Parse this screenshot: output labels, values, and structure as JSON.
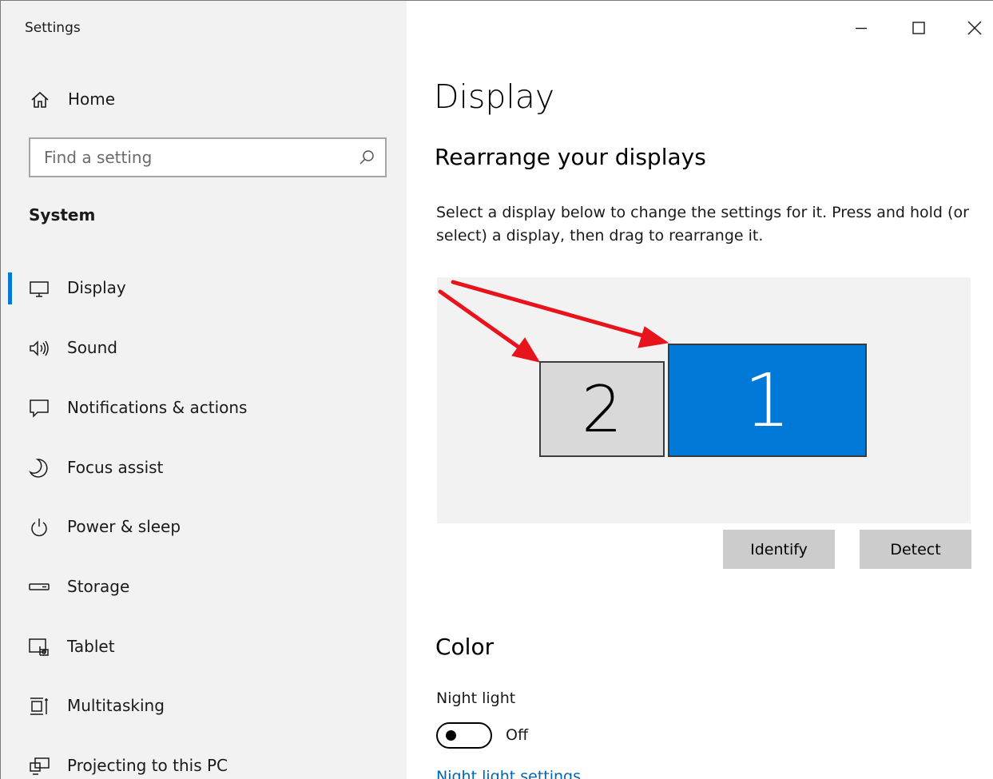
{
  "app": {
    "title": "Settings"
  },
  "window_controls": {
    "minimize": "minimize-icon",
    "maximize": "maximize-icon",
    "close": "close-icon"
  },
  "sidebar": {
    "home": {
      "label": "Home",
      "icon": "home-icon"
    },
    "search": {
      "placeholder": "Find a setting",
      "icon": "search-icon"
    },
    "section": "System",
    "items": [
      {
        "label": "Display",
        "icon": "monitor-icon",
        "active": true
      },
      {
        "label": "Sound",
        "icon": "speaker-icon"
      },
      {
        "label": "Notifications & actions",
        "icon": "notification-icon"
      },
      {
        "label": "Focus assist",
        "icon": "moon-icon"
      },
      {
        "label": "Power & sleep",
        "icon": "power-icon"
      },
      {
        "label": "Storage",
        "icon": "storage-icon"
      },
      {
        "label": "Tablet",
        "icon": "tablet-icon"
      },
      {
        "label": "Multitasking",
        "icon": "multitasking-icon"
      },
      {
        "label": "Projecting to this PC",
        "icon": "projecting-icon"
      }
    ]
  },
  "main": {
    "title": "Display",
    "rearrange": {
      "heading": "Rearrange your displays",
      "description": "Select a display below to change the settings for it. Press and hold (or select) a display, then drag to rearrange it.",
      "displays": [
        {
          "number": "2",
          "selected": false
        },
        {
          "number": "1",
          "selected": true
        }
      ],
      "identify_label": "Identify",
      "detect_label": "Detect"
    },
    "color": {
      "heading": "Color",
      "night_light_label": "Night light",
      "night_light_state": "Off",
      "night_light_on": false,
      "night_light_settings_link": "Night light settings"
    }
  },
  "colors": {
    "accent": "#0078d7",
    "annotation_arrow": "#e8141b",
    "sidebar_bg": "#f2f2f2"
  }
}
